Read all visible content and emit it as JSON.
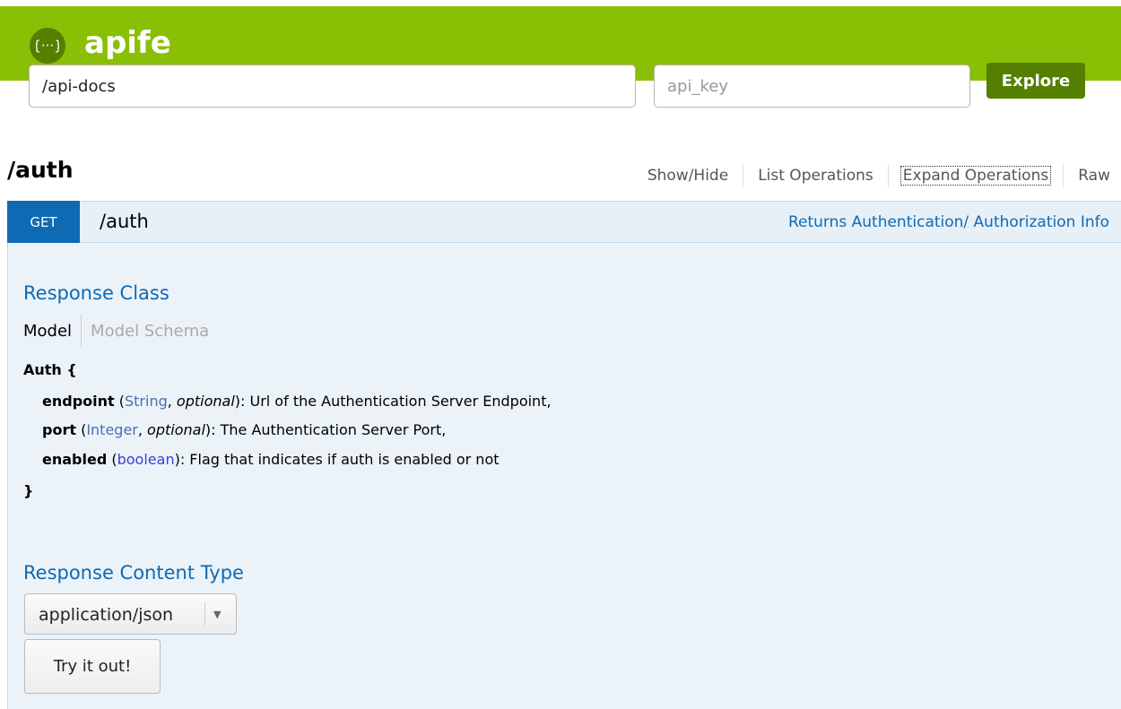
{
  "header": {
    "app_name": "apife",
    "logo_icon": "braces-dots-icon",
    "url_value": "/api-docs",
    "api_key_placeholder": "api_key",
    "explore_label": "Explore",
    "colors": {
      "header_bg": "#89bf04",
      "button_bg": "#547f00"
    }
  },
  "resource": {
    "title": "/auth",
    "links": [
      "Show/Hide",
      "List Operations",
      "Expand Operations",
      "Raw"
    ]
  },
  "operation": {
    "method": "GET",
    "path": "/auth",
    "summary": "Returns Authentication/ Authorization Info",
    "colors": {
      "method_bg": "#0f6ab4",
      "heading_bg": "#e7f0f7"
    },
    "response_class_title": "Response Class",
    "model_tabs": {
      "model": "Model",
      "schema": "Model Schema"
    },
    "model": {
      "open": "Auth {",
      "fields": [
        {
          "name": "endpoint",
          "type": "String",
          "qualifier": "optional",
          "description": "Url of the Authentication Server Endpoint,"
        },
        {
          "name": "port",
          "type": "Integer",
          "qualifier": "optional",
          "description": "The Authentication Server Port,"
        },
        {
          "name": "enabled",
          "type": "boolean",
          "qualifier": "",
          "description": "Flag that indicates if auth is enabled or not"
        }
      ],
      "close": "}"
    },
    "response_content_type_title": "Response Content Type",
    "content_type_selected": "application/json",
    "try_label": "Try it out!"
  }
}
